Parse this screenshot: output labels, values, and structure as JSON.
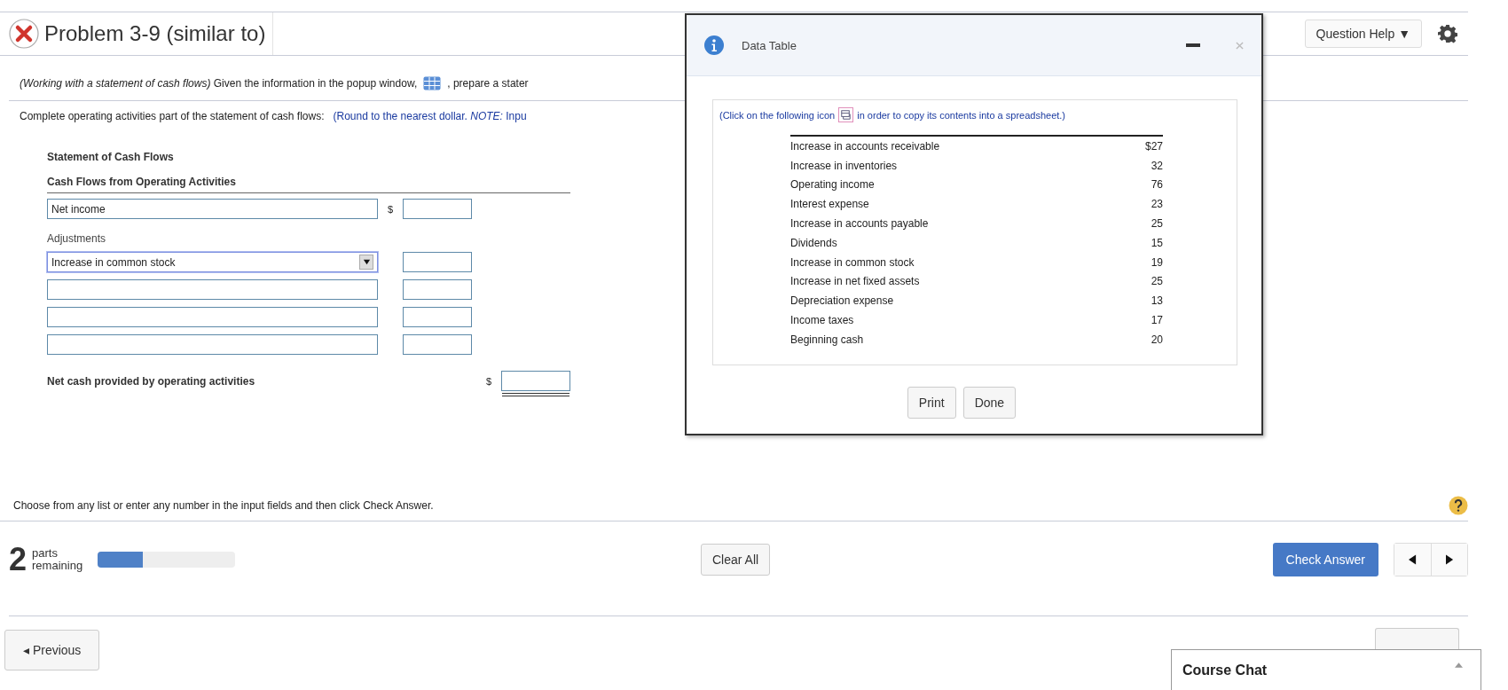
{
  "problem": {
    "title": "Problem 3-9 (similar to)",
    "incorrect": true
  },
  "header": {
    "help_button": "Question Help ▼"
  },
  "question": {
    "intro": "*(Working with a statement of cash flows)* Given the information in the popup window,",
    "after_icon": ", prepare a stater"
  },
  "instruction": {
    "text": "Complete operating activities part of the statement of cash flows:",
    "hint": "(Round to the nearest dollar. *NOTE:* Inpu"
  },
  "statement": {
    "title": "Statement of Cash Flows",
    "section": "Cash Flows from Operating Activities",
    "net_income": {
      "label": "Net income",
      "currency": "$"
    },
    "adjustments_label": "Adjustments",
    "adjustments": [
      {
        "kind": "select",
        "value": "Increase in common stock",
        "focused": true
      },
      {
        "kind": "select",
        "focused": false
      },
      {
        "kind": "select",
        "focused": false
      },
      {
        "kind": "select",
        "focused": false
      }
    ],
    "total": {
      "label": "Net cash provided by operating activities",
      "currency": "$"
    }
  },
  "footer_note": "Choose from any list or enter any number in the input fields and then click Check Answer.",
  "progress": {
    "count": "2",
    "label": "parts remaining",
    "level": 0.33
  },
  "buttons": {
    "clear": "Clear All",
    "check": "Check Answer",
    "previous": "◂ Previous"
  },
  "popup": {
    "title": "Data Table",
    "note_before": "(Click on the following icon",
    "note_after": "in order to copy its contents into a spreadsheet.)",
    "rows": [
      {
        "label": "Increase in accounts receivable",
        "value": "$27"
      },
      {
        "label": "Increase in inventories",
        "value": "32"
      },
      {
        "label": "Operating income",
        "value": "76"
      },
      {
        "label": "Interest expense",
        "value": "23"
      },
      {
        "label": "Increase in accounts payable",
        "value": "25"
      },
      {
        "label": "Dividends",
        "value": "15"
      },
      {
        "label": "Increase in common stock",
        "value": "19"
      },
      {
        "label": "Increase in net fixed assets",
        "value": "25"
      },
      {
        "label": "Depreciation expense",
        "value": "13"
      },
      {
        "label": "Income taxes",
        "value": "17"
      },
      {
        "label": "Beginning cash",
        "value": "20"
      }
    ],
    "buttons": [
      "Print",
      "Done"
    ]
  },
  "chat": {
    "title": "Course Chat"
  }
}
